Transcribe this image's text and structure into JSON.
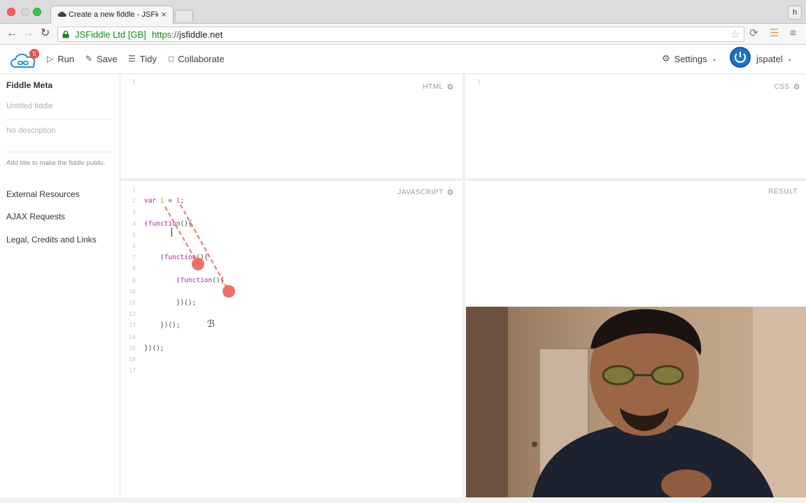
{
  "browser": {
    "tab_title": "Create a new fiddle - JSFiddle",
    "tab_close": "×",
    "profile_letter": "h",
    "ev_cert": "JSFiddle Ltd [GB]",
    "url_scheme": "https://",
    "url_host": "jsfiddle.net"
  },
  "header": {
    "logo_badge": "5",
    "run_label": "Run",
    "save_label": "Save",
    "tidy_label": "Tidy",
    "collaborate_label": "Collaborate",
    "settings_label": "Settings",
    "username": "jspatel"
  },
  "sidebar": {
    "title": "Fiddle Meta",
    "name_placeholder": "Untitled fiddle",
    "description_placeholder": "No description",
    "hint": "Add title to make the fiddle public.",
    "links": [
      "External Resources",
      "AJAX Requests",
      "Legal, Credits and Links"
    ]
  },
  "panes": {
    "html_label": "HTML",
    "css_label": "CSS",
    "js_label": "JAVASCRIPT",
    "result_label": "RESULT",
    "html_line": "1",
    "css_line": "1"
  },
  "js_code": {
    "line_numbers": [
      "1",
      "2",
      "3",
      "4",
      "5",
      "6",
      "7",
      "8",
      "9",
      "10",
      "11",
      "12",
      "13",
      "14",
      "15",
      "16",
      "17"
    ],
    "lines": [
      "",
      "var i = 1;",
      "",
      "(function(){",
      "",
      "",
      "    (function(){",
      "",
      "        (function(){",
      "",
      "        })();",
      "",
      "    })();",
      "",
      "})();",
      "",
      ""
    ]
  },
  "colors": {
    "accent": "#1a73c7",
    "badge": "#e8534c",
    "annotation": "#f0615c",
    "keyword": "#a626a4",
    "variable": "#c18401",
    "number": "#e45649"
  }
}
